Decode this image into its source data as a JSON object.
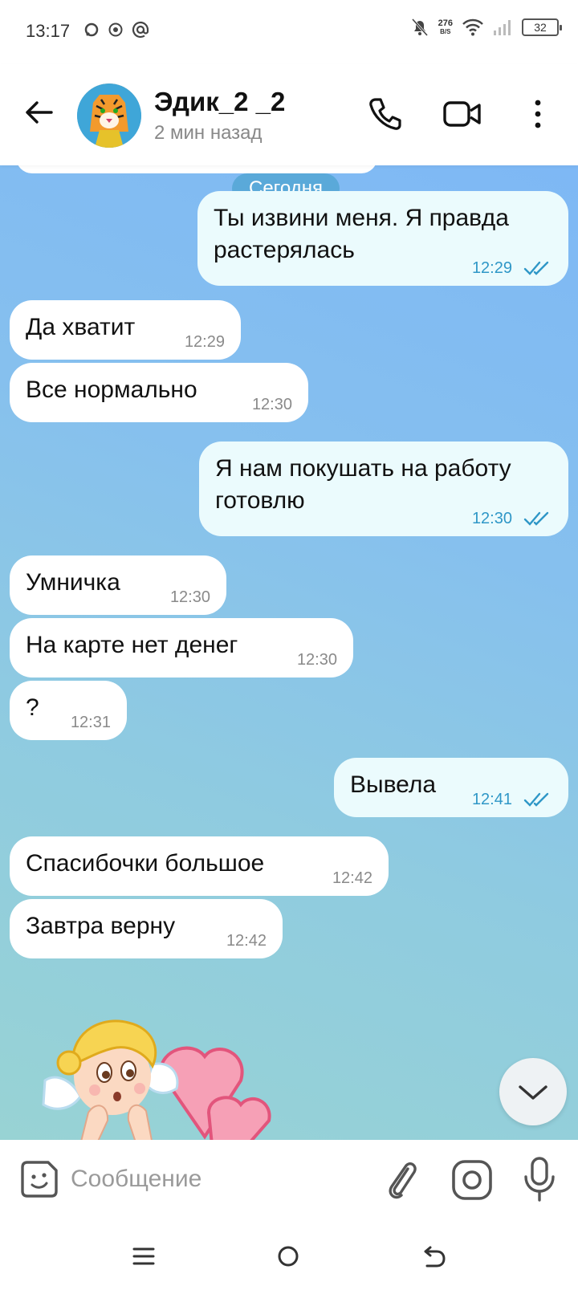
{
  "status_bar": {
    "time": "13:17",
    "net_speed_value": "276",
    "net_speed_unit": "B/S",
    "battery": "32"
  },
  "header": {
    "contact_name": "Эдик_2 _2",
    "contact_status": "2 мин назад"
  },
  "chat": {
    "date_separator": "Сегодня",
    "messages": [
      {
        "direction": "out",
        "text": "Ты извини меня. Я правда\nрастерялась",
        "time": "12:29",
        "read": true
      },
      {
        "direction": "in",
        "text": "Да хватит",
        "time": "12:29"
      },
      {
        "direction": "in",
        "text": "Все нормально",
        "time": "12:30"
      },
      {
        "direction": "out",
        "text": "Я нам покушать на работу\nготовлю",
        "time": "12:30",
        "read": true
      },
      {
        "direction": "in",
        "text": "Умничка",
        "time": "12:30"
      },
      {
        "direction": "in",
        "text": "На карте нет денег",
        "time": "12:30"
      },
      {
        "direction": "in",
        "text": "?",
        "time": "12:31"
      },
      {
        "direction": "out",
        "text": "Вывела",
        "time": "12:41",
        "read": true
      },
      {
        "direction": "in",
        "text": "Спасибочки большое",
        "time": "12:42"
      },
      {
        "direction": "in",
        "text": "Завтра верну",
        "time": "12:42"
      }
    ]
  },
  "input_bar": {
    "placeholder": "Сообщение"
  },
  "colors": {
    "accent": "#2f97c7",
    "outgoing_bubble": "#ebfbfd",
    "incoming_bubble": "#ffffff"
  }
}
